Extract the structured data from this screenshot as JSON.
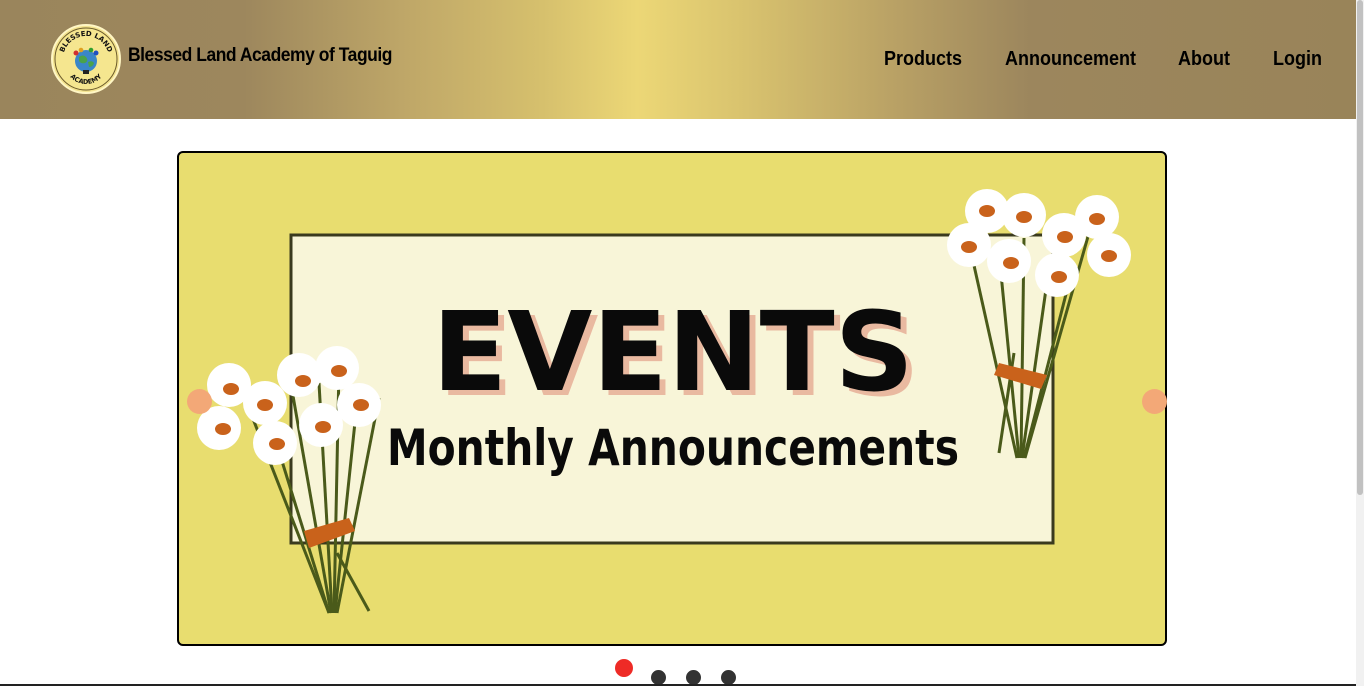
{
  "header": {
    "brand": "Blessed Land Academy of Taguig",
    "logo_text_top": "BLESSED LAND",
    "logo_text_bottom": "ACADEMY",
    "nav": [
      "Products",
      "Announcement",
      "About",
      "Login"
    ]
  },
  "carousel": {
    "slide_title": "EVENTS",
    "slide_subtitle": "Monthly Announcements",
    "active_slide": 1,
    "slide_count": 4
  },
  "colors": {
    "header_gradient_dark": "#9a855c",
    "header_gradient_light": "#ecd776",
    "slide_background": "#e8dd6f",
    "banner_background": "#f8f5d8",
    "arrow": "#f3a877",
    "active_dot": "#ee2b26",
    "inactive_dot": "#333333"
  },
  "icons": {
    "logo": "school-logo-icon",
    "prev": "arrow-prev-icon",
    "next": "arrow-next-icon"
  }
}
